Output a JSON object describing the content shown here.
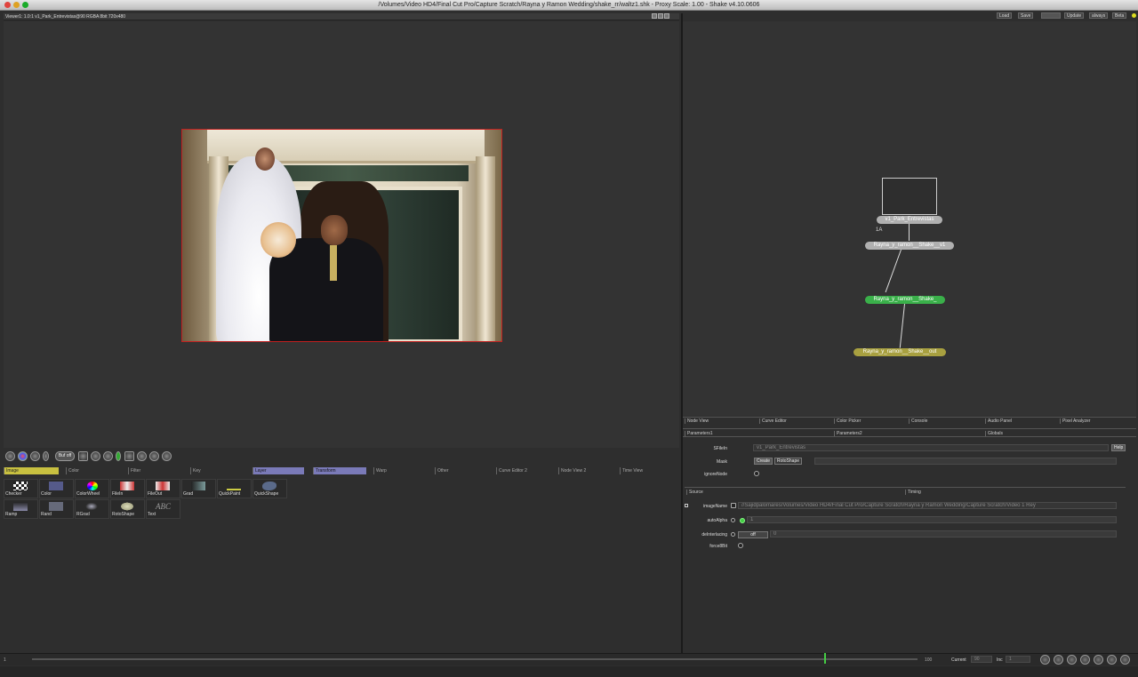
{
  "window": {
    "title": "/Volumes/Video HD4/Final Cut Pro/Capture Scratch/Rayna y Ramon Wedding/shake_rr/waltz1.shk - Proxy Scale: 1.00 - Shake v4.10.0606"
  },
  "viewer": {
    "info": "Viewer1: 1.0:1 v1_Park_Entrevistas@90 RGBA 8bit 720x480",
    "buf_label": "Buf off"
  },
  "top_right_buttons": [
    "Load",
    "Save",
    "Update",
    "always",
    "Beta"
  ],
  "tool_tabs": [
    "Image",
    "Color",
    "Filter",
    "Key",
    "Layer",
    "Transform",
    "Warp",
    "Other",
    "Curve Editor 2",
    "Node View 2",
    "Time View"
  ],
  "tools": [
    {
      "label": "Checker",
      "icon": "checker-icon"
    },
    {
      "label": "Color",
      "icon": "color-swatch-icon"
    },
    {
      "label": "ColorWheel",
      "icon": "color-wheel-icon"
    },
    {
      "label": "FileIn",
      "icon": "film-icon"
    },
    {
      "label": "FileOut",
      "icon": "film-out-icon"
    },
    {
      "label": "Grad",
      "icon": "gradient-icon"
    },
    {
      "label": "QuickPaint",
      "icon": "paint-icon"
    },
    {
      "label": "QuickShape",
      "icon": "shape-icon"
    },
    {
      "label": "Ramp",
      "icon": "ramp-icon"
    },
    {
      "label": "Rand",
      "icon": "noise-icon"
    },
    {
      "label": "RGrad",
      "icon": "radial-gradient-icon"
    },
    {
      "label": "RotoShape",
      "icon": "rotoshape-icon"
    },
    {
      "label": "Text",
      "icon": "text-icon",
      "glyph": "ABC"
    }
  ],
  "nodes": {
    "filein": "v1_Park_Entrevistas",
    "filein_frame": "1A",
    "node2": "Rayna_y_ramon__Shake__v1",
    "node3": "Rayna_y_ramon__Shake_",
    "node4": "Rayna_y_ramon__Shake__out"
  },
  "node_tabs": [
    "Node View",
    "Curve Editor",
    "Color Picker",
    "Console",
    "Audio Panel",
    "Pixel Analyzer"
  ],
  "param_tabs": [
    "Parameters1",
    "Parameters2",
    "Globals"
  ],
  "params": {
    "filein_label": "SFileIn",
    "filein_value": "v1_Park_Entrevistas",
    "help_label": "Help",
    "mask_label": "Mask",
    "create_label": "Create",
    "rotoshape_label": "RotoShape",
    "ignore_label": "ignoreNode",
    "source_tab": "Source",
    "timing_tab": "Timing",
    "image_name_label": "imageName",
    "image_name_value": "//Sajidpalomares/Volumes/Video HD4/Final Cut Pro/Capture Scratch/Rayna y Ramon Wedding/Capture Scratch/Video 1 Rey",
    "auto_alpha_label": "autoAlpha",
    "auto_alpha_value": "1",
    "deinterlacing_label": "deInterlacing",
    "deinterlacing_mode": "off",
    "deinterlacing_value": "0",
    "force8bit_label": "force8Bit"
  },
  "timeline": {
    "start": "1",
    "end": "100",
    "current_label": "Current",
    "current_value": "90",
    "inc_label": "Inc",
    "inc_value": "1"
  }
}
